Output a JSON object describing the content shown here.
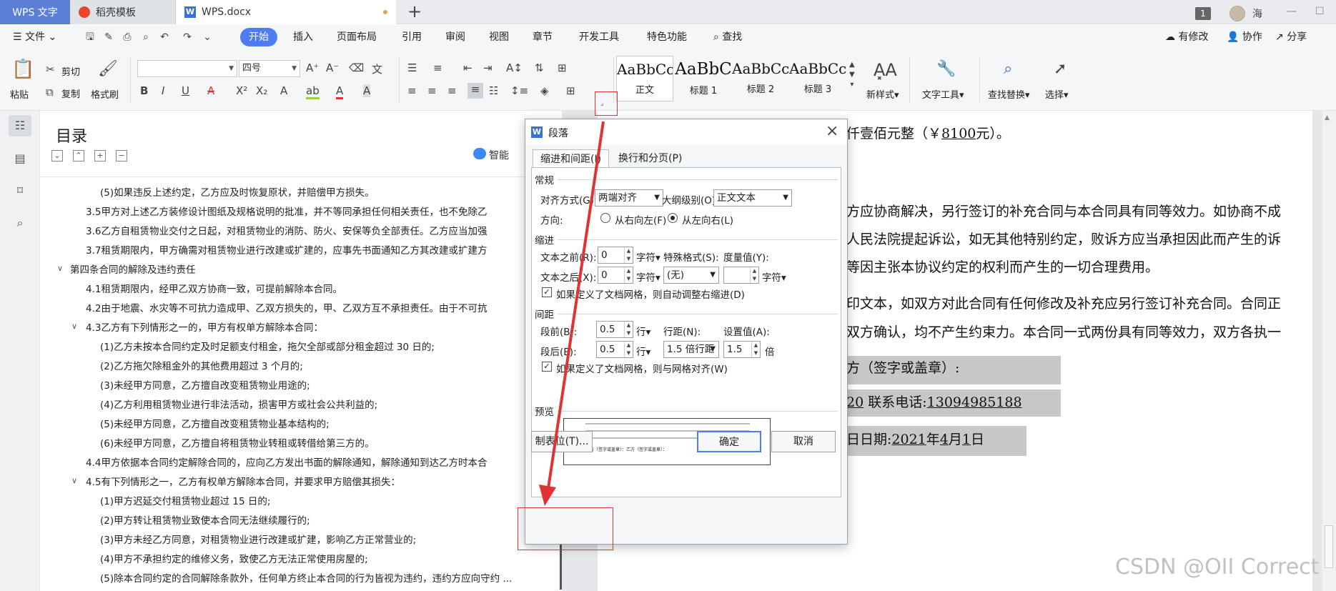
{
  "titlebar": {
    "tabs": [
      {
        "label": "WPS 文字"
      },
      {
        "label": "稻壳模板"
      },
      {
        "label": "WPS.docx"
      }
    ],
    "page_count": "1",
    "user": "海"
  },
  "menu": {
    "file": "文件",
    "items": [
      "开始",
      "插入",
      "页面布局",
      "引用",
      "审阅",
      "视图",
      "章节",
      "开发工具",
      "特色功能"
    ],
    "search": "查找",
    "right": [
      "有修改",
      "协作",
      "分享"
    ]
  },
  "ribbon": {
    "paste": "粘贴",
    "cut": "剪切",
    "copy": "复制",
    "format_painter": "格式刷",
    "font_name": "",
    "font_size": "四号",
    "styles": [
      {
        "preview": "AaBbCcDd",
        "name": "正文"
      },
      {
        "preview": "AaBbC",
        "name": "标题 1"
      },
      {
        "preview": "AaBbCcI",
        "name": "标题 2"
      },
      {
        "preview": "AaBbCcI",
        "name": "标题 3"
      }
    ],
    "new_style": "新样式",
    "text_tools": "文字工具",
    "find_replace": "查找替换",
    "select": "选择"
  },
  "toc": {
    "title": "目录",
    "smart": "智能",
    "items": [
      "(5)如果违反上述约定，乙方应及时恢复原状，并赔偿甲方损失。",
      "3.5甲方对上述乙方装修设计图纸及规格说明的批准，并不等同承担任何相关责任，也不免除乙",
      "3.6乙方自租赁物业交付之日起，对租赁物业的消防、防火、安保等负全部责任。乙方应当加强",
      "3.7租赁期限内，甲方确需对租赁物业进行改建或扩建的，应事先书面通知乙方其改建或扩建方",
      "第四条合同的解除及违约责任",
      "4.1租赁期限内，经甲乙双方协商一致，可提前解除本合同。",
      "4.2由于地震、水灾等不可抗力造成甲、乙双方损失的，甲、乙双方互不承担责任。由于不可抗",
      "4.3乙方有下列情形之一的，甲方有权单方解除本合同：",
      "(1)乙方未按本合同约定及时足额支付租金，拖欠全部或部分租金超过 30 日的;",
      "(2)乙方拖欠除租金外的其他费用超过 3 个月的;",
      "(3)未经甲方同意，乙方擅自改变租赁物业用途的;",
      "(4)乙方利用租赁物业进行非法活动，损害甲方或社会公共利益的;",
      "(5)未经甲方同意，乙方擅自改变租赁物业基本结构的;",
      "(6)未经甲方同意，乙方擅自将租赁物业转租或转借给第三方的。",
      "4.4甲方依据本合同约定解除合同的，应向乙方发出书面的解除通知，解除通知到达乙方时本合",
      "4.5有下列情形之一，乙方有权单方解除本合同，并要求甲方赔偿其损失：",
      "(1)甲方迟延交付租赁物业超过 15 日的;",
      "(2)甲方转让租赁物业致使本合同无法继续履行的;",
      "(3)甲方未经乙方同意，对租赁物业进行改建或扩建，影响乙方正常营业的;",
      "(4)甲方不承担约定的维修义务，致使乙方无法正常使用房屋的;",
      "(5)除本合同约定的合同解除条款外，任何单方终止本合同的行为皆视为违约，违约方应向守约 ..."
    ]
  },
  "document": {
    "line1a": "仟壹佰元整（￥",
    "line1b": "8100",
    "line1c": "元）。",
    "line2": "方应协商解决，另行签订的补充合同与本合同具有同等效力。如协商不成",
    "line3": "人民法院提起诉讼，如无其他特别约定，败诉方应当承担因此而产生的诉",
    "line4": "等因主张本协议约定的权利而产生的一切合理费用。",
    "line5": "印文本，如双方对此合同有任何修改及补充应另行签订补充合同。合同正",
    "line6": "双方确认，均不产生约束力。本合同一式两份具有同等效力，双方各执一",
    "line7": "方（签字或盖章）:",
    "line8a": "20",
    "line8b": "联系电话:",
    "line8c": "13094985188",
    "line9a": "日日期:",
    "line9b": "2021",
    "line9c": "年",
    "line9d": "4",
    "line9e": "月",
    "line9f": "1",
    "line9g": "日"
  },
  "dialog": {
    "title": "段落",
    "tab1": "缩进和间距(I)",
    "tab2": "换行和分页(P)",
    "general": "常规",
    "align_label": "对齐方式(G):",
    "align_value": "两端对齐",
    "outline_label": "大纲级别(O):",
    "outline_value": "正文文本",
    "direction_label": "方向:",
    "rtl": "从右向左(F)",
    "ltr": "从左向右(L)",
    "indent": "缩进",
    "before_text_label": "文本之前(R):",
    "before_text_value": "0",
    "before_text_unit": "字符",
    "special_label": "特殊格式(S):",
    "measure_label": "度量值(Y):",
    "after_text_label": "文本之后(X):",
    "after_text_value": "0",
    "after_text_unit": "字符",
    "special_value": "(无)",
    "measure_unit": "字符",
    "auto_indent": "如果定义了文档网格，则自动调整右缩进(D)",
    "spacing": "间距",
    "before_label": "段前(B):",
    "before_value": "0.5",
    "before_unit": "行",
    "line_spacing_label": "行距(N):",
    "set_value_label": "设置值(A):",
    "after_label": "段后(E):",
    "after_value": "0.5",
    "after_unit": "行",
    "line_spacing_value": "1.5 倍行距",
    "set_value": "1.5",
    "set_unit": "倍",
    "grid_align": "如果定义了文档网格，则与网格对齐(W)",
    "preview_label": "预览",
    "preview_sample": "甲方（签字或盖章）：乙方（签字或盖章）：",
    "tabs_button": "制表位(T)...",
    "ok": "确定",
    "cancel": "取消"
  },
  "watermark": "CSDN @OII Correct",
  "colors": {
    "accent": "#4d7cf5",
    "annotation": "#e03333",
    "highlight": "#c8c8c8"
  }
}
